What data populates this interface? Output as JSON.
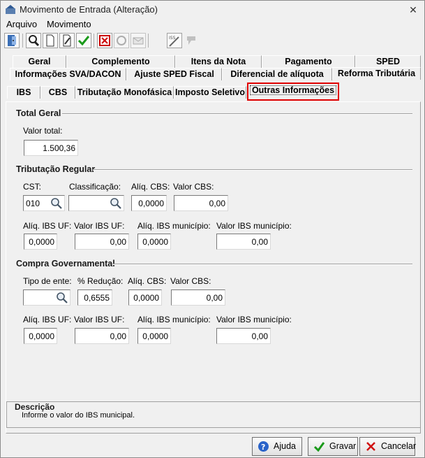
{
  "window": {
    "title": "Movimento de Entrada (Alteração)",
    "close": "✕"
  },
  "menu": [
    "Arquivo",
    "Movimento"
  ],
  "toolbar": [
    "door-icon",
    "search-icon",
    "new-doc-icon",
    "edit-doc-icon",
    "confirm-check-icon",
    "delete-icon",
    "refresh-icon",
    "mail-icon",
    "iss-icon",
    "disabled-icon"
  ],
  "tabs": {
    "row1": [
      "Geral",
      "Complemento",
      "Itens da Nota",
      "Pagamento",
      "SPED"
    ],
    "row2": [
      "Informações SVA/DACON",
      "Ajuste SPED Fiscal",
      "Diferencial de alíquota",
      "Reforma Tributária"
    ],
    "row3": [
      "IBS",
      "CBS",
      "Tributação Monofásica",
      "Imposto Seletivo",
      "Outras Informações"
    ]
  },
  "total_geral": {
    "heading": "Total Geral",
    "valor_total_label": "Valor total:",
    "valor_total": "1.500,36"
  },
  "tributacao_regular": {
    "heading": "Tributação Regular",
    "cst_label": "CST:",
    "cst": "010",
    "classificacao_label": "Classificação:",
    "classificacao": "",
    "aliq_cbs_label": "Alíq. CBS:",
    "aliq_cbs": "0,0000",
    "valor_cbs_label": "Valor CBS:",
    "valor_cbs": "0,00",
    "aliq_ibs_uf_label": "Alíq. IBS UF:",
    "aliq_ibs_uf": "0,0000",
    "valor_ibs_uf_label": "Valor IBS UF:",
    "valor_ibs_uf": "0,00",
    "aliq_ibs_mun_label": "Alíq. IBS município:",
    "aliq_ibs_mun": "0,0000",
    "valor_ibs_mun_label": "Valor IBS município:",
    "valor_ibs_mun": "0,00"
  },
  "compra_governamental": {
    "heading": "Compra Governamental",
    "tipo_ente_label": "Tipo de ente:",
    "tipo_ente": "",
    "reducao_label": "% Redução:",
    "reducao": "0,6555",
    "aliq_cbs_label": "Alíq. CBS:",
    "aliq_cbs": "0,0000",
    "valor_cbs_label": "Valor CBS:",
    "valor_cbs": "0,00",
    "aliq_ibs_uf_label": "Alíq. IBS UF:",
    "aliq_ibs_uf": "0,0000",
    "valor_ibs_uf_label": "Valor IBS UF:",
    "valor_ibs_uf": "0,00",
    "aliq_ibs_mun_label": "Alíq. IBS município:",
    "aliq_ibs_mun": "0,0000",
    "valor_ibs_mun_label": "Valor IBS município:",
    "valor_ibs_mun": "0,00"
  },
  "descricao": {
    "heading": "Descrição",
    "text": "Informe o valor do IBS municipal."
  },
  "buttons": {
    "ajuda": "Ajuda",
    "gravar": "Gravar",
    "cancelar": "Cancelar"
  },
  "colors": {
    "highlight": "#e00000",
    "confirm": "#1a9a1a",
    "cancel": "#d01010",
    "help": "#2a63c9"
  }
}
